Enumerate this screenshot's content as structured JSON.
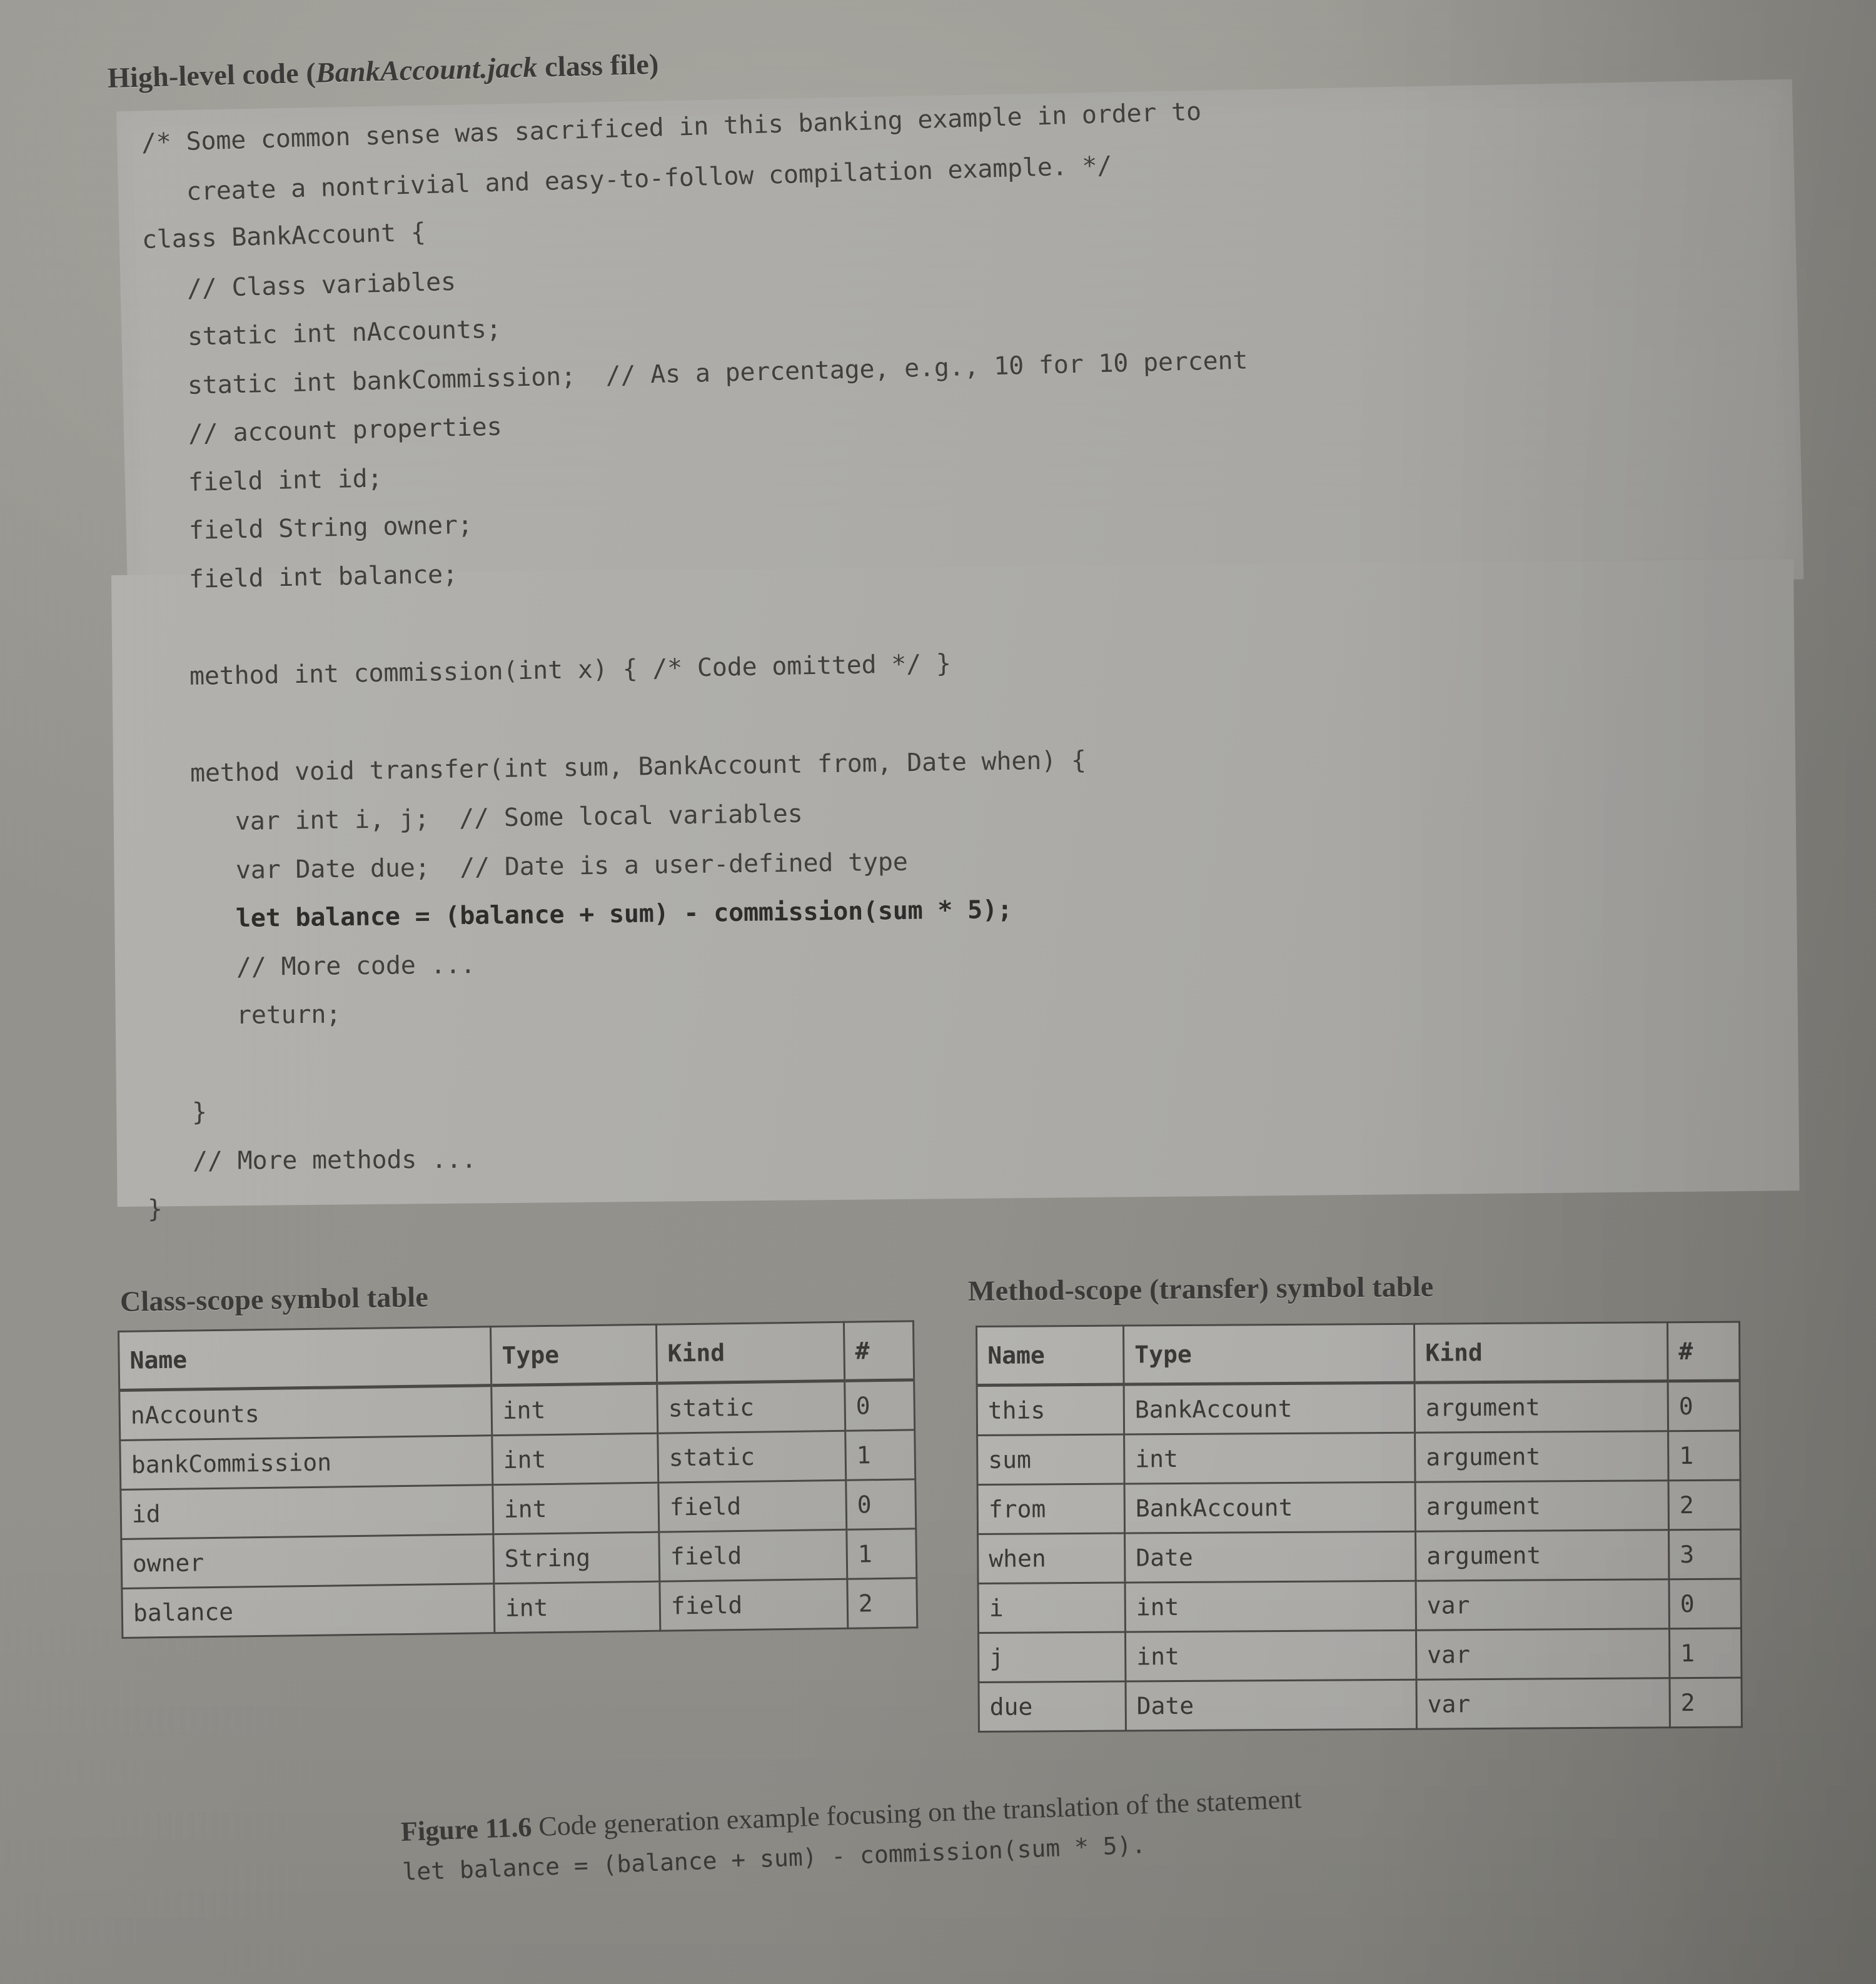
{
  "page": {
    "background_color": "#c5c4c0",
    "code_panel_color": "#adaca8",
    "ink_color": "#3b3a38"
  },
  "high_level_code": {
    "heading_prefix": "High-level code (",
    "heading_italic": "BankAccount.jack",
    "heading_suffix": " class file)",
    "lines": [
      {
        "text": "/* Some common sense was sacrificed in this banking example in order to",
        "indent": 0,
        "bold": false
      },
      {
        "text": "create a nontrivial and easy-to-follow compilation example. */",
        "indent": 1,
        "bold": false
      },
      {
        "text": "class BankAccount {",
        "indent": 0,
        "bold": false
      },
      {
        "text": "// Class variables",
        "indent": 1,
        "bold": false
      },
      {
        "text": "static int nAccounts;",
        "indent": 1,
        "bold": false
      },
      {
        "text": "static int bankCommission;  // As a percentage, e.g., 10 for 10 percent",
        "indent": 1,
        "bold": false
      },
      {
        "text": "// account properties",
        "indent": 1,
        "bold": false
      },
      {
        "text": "field int id;",
        "indent": 1,
        "bold": false
      },
      {
        "text": "field String owner;",
        "indent": 1,
        "bold": false
      },
      {
        "text": "field int balance;",
        "indent": 1,
        "bold": false
      },
      {
        "text": "",
        "indent": 0,
        "bold": false
      },
      {
        "text": "method int commission(int x) { /* Code omitted */ }",
        "indent": 1,
        "bold": false
      },
      {
        "text": "",
        "indent": 0,
        "bold": false
      },
      {
        "text": "method void transfer(int sum, BankAccount from, Date when) {",
        "indent": 1,
        "bold": false
      },
      {
        "text": "var int i, j;  // Some local variables",
        "indent": 2,
        "bold": false
      },
      {
        "text": "var Date due;  // Date is a user-defined type",
        "indent": 2,
        "bold": false
      },
      {
        "text": "let balance = (balance + sum) - commission(sum * 5);",
        "indent": 2,
        "bold": true
      },
      {
        "text": "// More code ...",
        "indent": 2,
        "bold": false
      },
      {
        "text": "return;",
        "indent": 2,
        "bold": false
      },
      {
        "text": "",
        "indent": 0,
        "bold": false
      },
      {
        "text": "}",
        "indent": 1,
        "bold": false
      },
      {
        "text": "// More methods ...",
        "indent": 1,
        "bold": false
      },
      {
        "text": "}",
        "indent": 0,
        "bold": false
      }
    ]
  },
  "class_scope_table": {
    "title": "Class-scope symbol table",
    "columns": [
      "Name",
      "Type",
      "Kind",
      "#"
    ],
    "rows": [
      [
        "nAccounts",
        "int",
        "static",
        "0"
      ],
      [
        "bankCommission",
        "int",
        "static",
        "1"
      ],
      [
        "id",
        "int",
        "field",
        "0"
      ],
      [
        "owner",
        "String",
        "field",
        "1"
      ],
      [
        "balance",
        "int",
        "field",
        "2"
      ]
    ]
  },
  "method_scope_table": {
    "title": "Method-scope (transfer) symbol table",
    "columns": [
      "Name",
      "Type",
      "Kind",
      "#"
    ],
    "rows": [
      [
        "this",
        "BankAccount",
        "argument",
        "0"
      ],
      [
        "sum",
        "int",
        "argument",
        "1"
      ],
      [
        "from",
        "BankAccount",
        "argument",
        "2"
      ],
      [
        "when",
        "Date",
        "argument",
        "3"
      ],
      [
        "i",
        "int",
        "var",
        "0"
      ],
      [
        "j",
        "int",
        "var",
        "1"
      ],
      [
        "due",
        "Date",
        "var",
        "2"
      ]
    ]
  },
  "caption": {
    "figure_number": "Figure 11.6",
    "text": "Code generation example focusing on the translation of the statement",
    "statement": "let balance = (balance + sum) - commission(sum * 5)."
  }
}
